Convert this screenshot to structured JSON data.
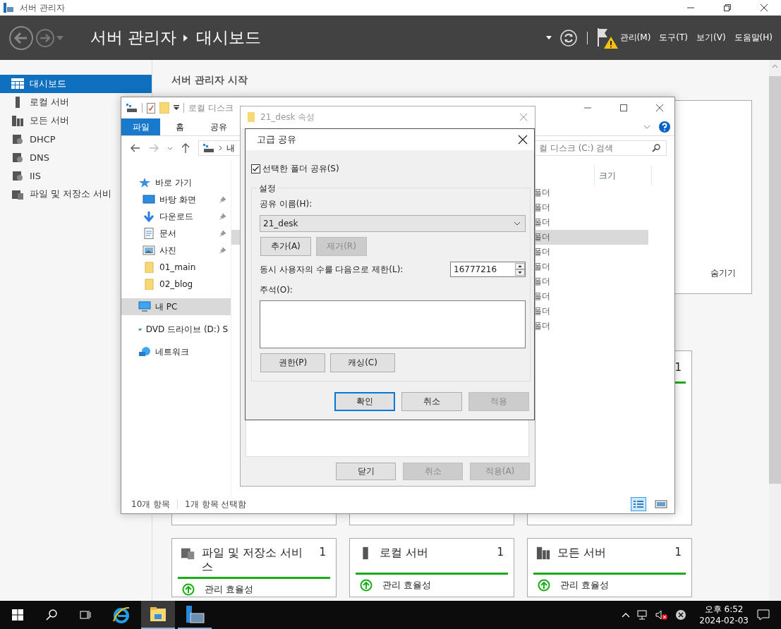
{
  "window": {
    "title": "서버 관리자"
  },
  "header": {
    "breadcrumb": [
      "서버 관리자",
      "대시보드"
    ],
    "menus": [
      "관리(M)",
      "도구(T)",
      "보기(V)",
      "도움말(H)"
    ]
  },
  "sidebar": {
    "items": [
      {
        "label": "대시보드",
        "selected": true
      },
      {
        "label": "로컬 서버",
        "selected": false
      },
      {
        "label": "모든 서버",
        "selected": false
      },
      {
        "label": "DHCP",
        "selected": false
      },
      {
        "label": "DNS",
        "selected": false
      },
      {
        "label": "IIS",
        "selected": false
      },
      {
        "label": "파일 및 저장소 서비",
        "selected": false
      }
    ]
  },
  "main": {
    "heading": "서버 관리자 시작",
    "hide_link": "숨기기",
    "upper_tile_count": "1",
    "tiles": [
      {
        "title": "파일 및 저장소 서비스",
        "count": "1",
        "status": "관리 효율성"
      },
      {
        "title": "로컬 서버",
        "count": "1",
        "status": "관리 효율성"
      },
      {
        "title": "모든 서버",
        "count": "1",
        "status": "관리 효율성"
      }
    ]
  },
  "explorer": {
    "title": "로컬 디스크",
    "ribbon_tabs": [
      {
        "label": "파일",
        "selected": true
      },
      {
        "label": "홈",
        "selected": false
      },
      {
        "label": "공유",
        "selected": false
      }
    ],
    "address": "내",
    "search_placeholder": "컬 디스크 (C:) 검색",
    "column_header": "크기",
    "nav": [
      {
        "label": "바로 가기",
        "selected": false,
        "children": [
          {
            "label": "바탕 화면",
            "pinned": true,
            "selected": false
          },
          {
            "label": "다운로드",
            "pinned": true,
            "selected": false
          },
          {
            "label": "문서",
            "pinned": true,
            "selected": false
          },
          {
            "label": "사진",
            "pinned": true,
            "selected": false
          },
          {
            "label": "01_main",
            "pinned": false,
            "selected": false
          },
          {
            "label": "02_blog",
            "pinned": false,
            "selected": false
          }
        ]
      },
      {
        "label": "내 PC",
        "selected": true
      },
      {
        "label": "DVD 드라이브 (D:) S",
        "selected": false
      },
      {
        "label": "네트워크",
        "selected": false
      }
    ],
    "rows": [
      {
        "type": "폴더",
        "selected": false
      },
      {
        "type": "폴더",
        "selected": false
      },
      {
        "type": "폴더",
        "selected": false
      },
      {
        "type": "폴더",
        "selected": true
      },
      {
        "type": "폴더",
        "selected": false
      },
      {
        "type": "폴더",
        "selected": false
      },
      {
        "type": "폴더",
        "selected": false
      },
      {
        "type": "폴더",
        "selected": false
      },
      {
        "type": "폴더",
        "selected": false
      },
      {
        "type": "폴더",
        "selected": false
      }
    ],
    "status": [
      "10개 항목",
      "1개 항목 선택함"
    ],
    "view_modes": [
      {
        "selected": true
      },
      {
        "selected": false
      }
    ]
  },
  "properties": {
    "title": "21_desk 속성",
    "buttons": [
      {
        "label": "닫기",
        "disabled": false
      },
      {
        "label": "취소",
        "disabled": true
      },
      {
        "label": "적용(A)",
        "disabled": true
      }
    ]
  },
  "advanced_sharing": {
    "title": "고급 공유",
    "share_checkbox": {
      "label": "선택한 폴더 공유(S)",
      "checked": true
    },
    "group_label": "설정",
    "share_name_label": "공유 이름(H):",
    "share_name": "21_desk",
    "name_buttons": [
      {
        "label": "추가(A)",
        "disabled": false
      },
      {
        "label": "제거(R)",
        "disabled": true
      }
    ],
    "limit_label": "동시 사용자의 수를 다음으로 제한(L):",
    "limit_value": "16777216",
    "comment_label": "주석(O):",
    "group_buttons": [
      "권한(P)",
      "캐싱(C)"
    ],
    "buttons": [
      {
        "label": "확인",
        "default": true,
        "disabled": false
      },
      {
        "label": "취소",
        "default": false,
        "disabled": false
      },
      {
        "label": "적용",
        "default": false,
        "disabled": true
      }
    ]
  },
  "taskbar": {
    "apps": [
      {
        "running": false,
        "active": false
      },
      {
        "running": true,
        "active": true
      },
      {
        "running": true,
        "active": false
      }
    ],
    "time": "오후 6:52",
    "date": "2024-02-03"
  }
}
